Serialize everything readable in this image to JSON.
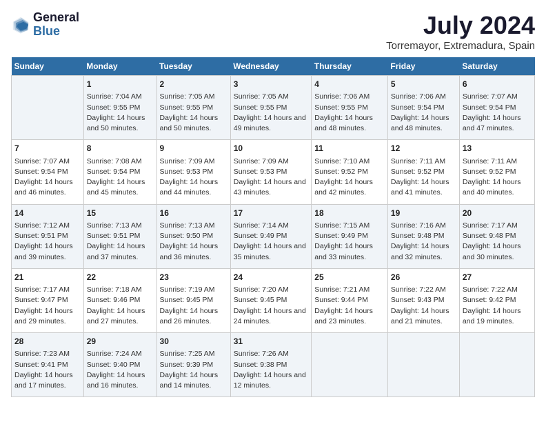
{
  "logo": {
    "line1": "General",
    "line2": "Blue"
  },
  "title": "July 2024",
  "subtitle": "Torremayor, Extremadura, Spain",
  "days_header": [
    "Sunday",
    "Monday",
    "Tuesday",
    "Wednesday",
    "Thursday",
    "Friday",
    "Saturday"
  ],
  "weeks": [
    [
      {
        "day": "",
        "sunrise": "",
        "sunset": "",
        "daylight": ""
      },
      {
        "day": "1",
        "sunrise": "Sunrise: 7:04 AM",
        "sunset": "Sunset: 9:55 PM",
        "daylight": "Daylight: 14 hours and 50 minutes."
      },
      {
        "day": "2",
        "sunrise": "Sunrise: 7:05 AM",
        "sunset": "Sunset: 9:55 PM",
        "daylight": "Daylight: 14 hours and 50 minutes."
      },
      {
        "day": "3",
        "sunrise": "Sunrise: 7:05 AM",
        "sunset": "Sunset: 9:55 PM",
        "daylight": "Daylight: 14 hours and 49 minutes."
      },
      {
        "day": "4",
        "sunrise": "Sunrise: 7:06 AM",
        "sunset": "Sunset: 9:55 PM",
        "daylight": "Daylight: 14 hours and 48 minutes."
      },
      {
        "day": "5",
        "sunrise": "Sunrise: 7:06 AM",
        "sunset": "Sunset: 9:54 PM",
        "daylight": "Daylight: 14 hours and 48 minutes."
      },
      {
        "day": "6",
        "sunrise": "Sunrise: 7:07 AM",
        "sunset": "Sunset: 9:54 PM",
        "daylight": "Daylight: 14 hours and 47 minutes."
      }
    ],
    [
      {
        "day": "7",
        "sunrise": "Sunrise: 7:07 AM",
        "sunset": "Sunset: 9:54 PM",
        "daylight": "Daylight: 14 hours and 46 minutes."
      },
      {
        "day": "8",
        "sunrise": "Sunrise: 7:08 AM",
        "sunset": "Sunset: 9:54 PM",
        "daylight": "Daylight: 14 hours and 45 minutes."
      },
      {
        "day": "9",
        "sunrise": "Sunrise: 7:09 AM",
        "sunset": "Sunset: 9:53 PM",
        "daylight": "Daylight: 14 hours and 44 minutes."
      },
      {
        "day": "10",
        "sunrise": "Sunrise: 7:09 AM",
        "sunset": "Sunset: 9:53 PM",
        "daylight": "Daylight: 14 hours and 43 minutes."
      },
      {
        "day": "11",
        "sunrise": "Sunrise: 7:10 AM",
        "sunset": "Sunset: 9:52 PM",
        "daylight": "Daylight: 14 hours and 42 minutes."
      },
      {
        "day": "12",
        "sunrise": "Sunrise: 7:11 AM",
        "sunset": "Sunset: 9:52 PM",
        "daylight": "Daylight: 14 hours and 41 minutes."
      },
      {
        "day": "13",
        "sunrise": "Sunrise: 7:11 AM",
        "sunset": "Sunset: 9:52 PM",
        "daylight": "Daylight: 14 hours and 40 minutes."
      }
    ],
    [
      {
        "day": "14",
        "sunrise": "Sunrise: 7:12 AM",
        "sunset": "Sunset: 9:51 PM",
        "daylight": "Daylight: 14 hours and 39 minutes."
      },
      {
        "day": "15",
        "sunrise": "Sunrise: 7:13 AM",
        "sunset": "Sunset: 9:51 PM",
        "daylight": "Daylight: 14 hours and 37 minutes."
      },
      {
        "day": "16",
        "sunrise": "Sunrise: 7:13 AM",
        "sunset": "Sunset: 9:50 PM",
        "daylight": "Daylight: 14 hours and 36 minutes."
      },
      {
        "day": "17",
        "sunrise": "Sunrise: 7:14 AM",
        "sunset": "Sunset: 9:49 PM",
        "daylight": "Daylight: 14 hours and 35 minutes."
      },
      {
        "day": "18",
        "sunrise": "Sunrise: 7:15 AM",
        "sunset": "Sunset: 9:49 PM",
        "daylight": "Daylight: 14 hours and 33 minutes."
      },
      {
        "day": "19",
        "sunrise": "Sunrise: 7:16 AM",
        "sunset": "Sunset: 9:48 PM",
        "daylight": "Daylight: 14 hours and 32 minutes."
      },
      {
        "day": "20",
        "sunrise": "Sunrise: 7:17 AM",
        "sunset": "Sunset: 9:48 PM",
        "daylight": "Daylight: 14 hours and 30 minutes."
      }
    ],
    [
      {
        "day": "21",
        "sunrise": "Sunrise: 7:17 AM",
        "sunset": "Sunset: 9:47 PM",
        "daylight": "Daylight: 14 hours and 29 minutes."
      },
      {
        "day": "22",
        "sunrise": "Sunrise: 7:18 AM",
        "sunset": "Sunset: 9:46 PM",
        "daylight": "Daylight: 14 hours and 27 minutes."
      },
      {
        "day": "23",
        "sunrise": "Sunrise: 7:19 AM",
        "sunset": "Sunset: 9:45 PM",
        "daylight": "Daylight: 14 hours and 26 minutes."
      },
      {
        "day": "24",
        "sunrise": "Sunrise: 7:20 AM",
        "sunset": "Sunset: 9:45 PM",
        "daylight": "Daylight: 14 hours and 24 minutes."
      },
      {
        "day": "25",
        "sunrise": "Sunrise: 7:21 AM",
        "sunset": "Sunset: 9:44 PM",
        "daylight": "Daylight: 14 hours and 23 minutes."
      },
      {
        "day": "26",
        "sunrise": "Sunrise: 7:22 AM",
        "sunset": "Sunset: 9:43 PM",
        "daylight": "Daylight: 14 hours and 21 minutes."
      },
      {
        "day": "27",
        "sunrise": "Sunrise: 7:22 AM",
        "sunset": "Sunset: 9:42 PM",
        "daylight": "Daylight: 14 hours and 19 minutes."
      }
    ],
    [
      {
        "day": "28",
        "sunrise": "Sunrise: 7:23 AM",
        "sunset": "Sunset: 9:41 PM",
        "daylight": "Daylight: 14 hours and 17 minutes."
      },
      {
        "day": "29",
        "sunrise": "Sunrise: 7:24 AM",
        "sunset": "Sunset: 9:40 PM",
        "daylight": "Daylight: 14 hours and 16 minutes."
      },
      {
        "day": "30",
        "sunrise": "Sunrise: 7:25 AM",
        "sunset": "Sunset: 9:39 PM",
        "daylight": "Daylight: 14 hours and 14 minutes."
      },
      {
        "day": "31",
        "sunrise": "Sunrise: 7:26 AM",
        "sunset": "Sunset: 9:38 PM",
        "daylight": "Daylight: 14 hours and 12 minutes."
      },
      {
        "day": "",
        "sunrise": "",
        "sunset": "",
        "daylight": ""
      },
      {
        "day": "",
        "sunrise": "",
        "sunset": "",
        "daylight": ""
      },
      {
        "day": "",
        "sunrise": "",
        "sunset": "",
        "daylight": ""
      }
    ]
  ]
}
